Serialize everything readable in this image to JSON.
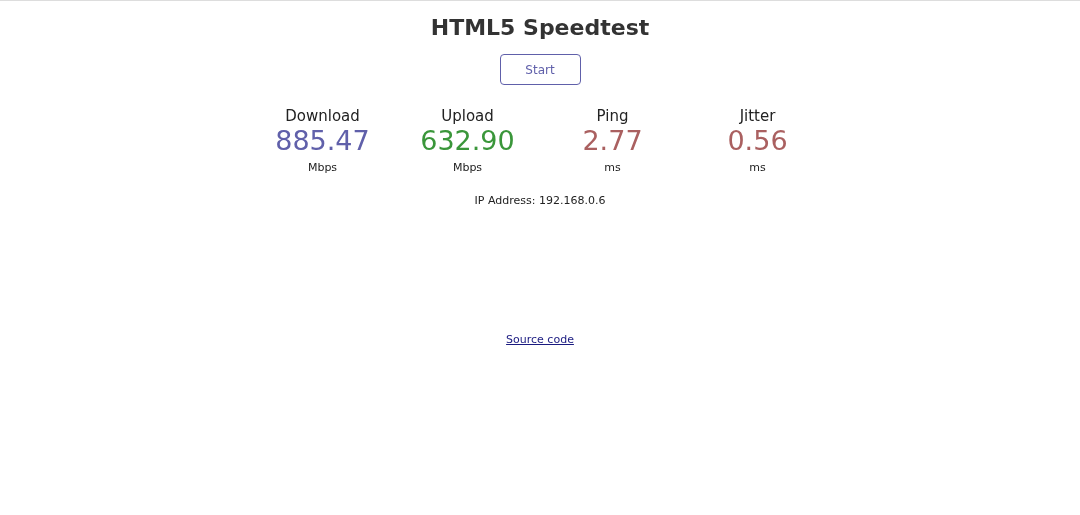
{
  "title": "HTML5 Speedtest",
  "start_button": {
    "label": "Start"
  },
  "metrics": [
    {
      "label": "Download",
      "value": "885.47",
      "unit": "Mbps",
      "color": "#6060aa"
    },
    {
      "label": "Upload",
      "value": "632.90",
      "unit": "Mbps",
      "color": "#3a963a"
    },
    {
      "label": "Ping",
      "value": "2.77",
      "unit": "ms",
      "color": "#aa6060"
    },
    {
      "label": "Jitter",
      "value": "0.56",
      "unit": "ms",
      "color": "#aa6060"
    }
  ],
  "ip_address": "IP Address: 192.168.0.6",
  "source_link": "Source code"
}
